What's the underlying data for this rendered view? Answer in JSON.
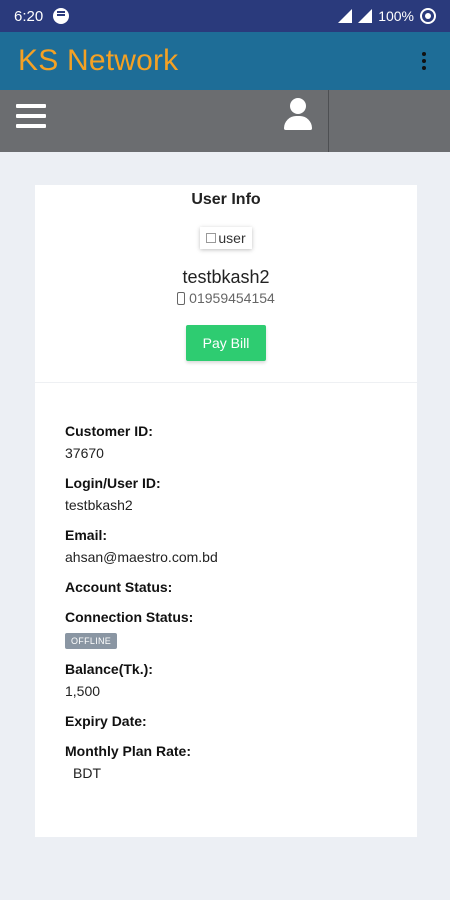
{
  "status_bar": {
    "time": "6:20",
    "battery": "100%"
  },
  "app_bar": {
    "title": "KS Network"
  },
  "card": {
    "title": "User Info",
    "avatar_alt": "user",
    "username": "testbkash2",
    "phone": "01959454154",
    "pay_button": "Pay Bill"
  },
  "fields": {
    "customer_id_label": "Customer ID:",
    "customer_id_value": "37670",
    "login_label": "Login/User ID:",
    "login_value": "testbkash2",
    "email_label": "Email:",
    "email_value": "ahsan@maestro.com.bd",
    "account_status_label": "Account Status:",
    "connection_status_label": "Connection Status:",
    "connection_status_value": "OFFLINE",
    "balance_label": "Balance(Tk.):",
    "balance_value": "1,500",
    "expiry_label": "Expiry Date:",
    "plan_rate_label": "Monthly Plan Rate:",
    "plan_rate_value": "BDT"
  },
  "colors": {
    "status_bar": "#2a3a7c",
    "app_bar": "#1e6d97",
    "title_accent": "#f4a124",
    "toolbar": "#6b6d70",
    "pay_button": "#2ecc71",
    "badge_offline": "#8a96a3"
  }
}
